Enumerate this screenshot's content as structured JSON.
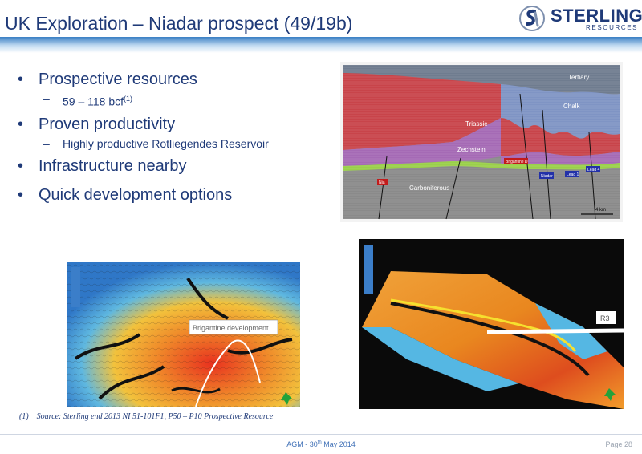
{
  "slide": {
    "title": "UK Exploration – Niadar prospect (49/19b)"
  },
  "logo": {
    "name": "STERLING",
    "tagline": "RESOURCES",
    "icon": "sterling-sr-logo-icon"
  },
  "bullets": [
    {
      "text": "Prospective resources",
      "sub": {
        "text": "59 – 118 bcf",
        "sup": "(1)"
      }
    },
    {
      "text": "Proven productivity",
      "sub": {
        "text": "Highly productive Rotliegendes Reservoir"
      }
    },
    {
      "text": "Infrastructure nearby"
    },
    {
      "text": "Quick development options"
    }
  ],
  "seismic_section": {
    "labels": {
      "tertiary": "Tertiary",
      "chalk": "Chalk",
      "triassic": "Triassic",
      "zechstein": "Zechstein",
      "carboniferous": "Carboniferous",
      "scale": "4 km"
    },
    "well_tags": [
      "Brigantine D",
      "Niadar",
      "Lead 1",
      "Lead 4",
      "Nia"
    ],
    "colors": {
      "tertiary": "#6f7c8f",
      "chalk": "#7f94c4",
      "triassic": "#c8444a",
      "zechstein": "#a56ab5",
      "rotliegend": "#9ad04a",
      "carboniferous": "#8a8a8a",
      "tag_red": "#c21b1b",
      "tag_blue": "#2331a8"
    }
  },
  "map_left": {
    "callout": "Brigantine development"
  },
  "map_right": {
    "callout": "R3"
  },
  "footnote": {
    "marker": "(1)",
    "text": "Source: Sterling end 2013 NI 51-101F1, P50 – P10 Prospective Resource"
  },
  "footer": {
    "event": "AGM - 30",
    "event_sup": "th",
    "event_tail": " May 2014",
    "page": "Page 28"
  }
}
